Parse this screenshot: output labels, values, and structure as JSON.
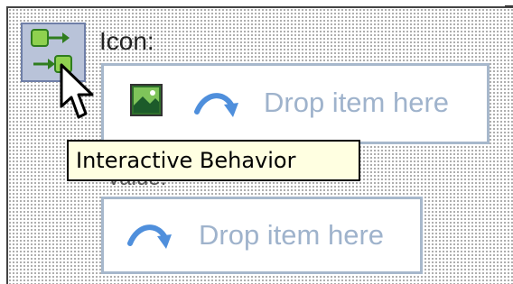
{
  "properties": {
    "icon_label": "Icon:",
    "value_label": "Value:",
    "icon_drop_text": "Drop item here",
    "value_drop_text": "Drop item here"
  },
  "tooltip": {
    "text": "Interactive Behavior"
  },
  "icons": {
    "behavior": "interactive-behavior-icon",
    "image": "image-thumbnail-icon",
    "drop_arrow": "curved-arrow-icon",
    "cursor": "mouse-pointer-icon"
  },
  "colors": {
    "drop_text": "#9fb3cc",
    "drop_border": "#a7b8cc",
    "arrow": "#4f8fdc",
    "tooltip_bg": "#ffffe1",
    "behavior_icon_bg": "#b9c3d9"
  }
}
